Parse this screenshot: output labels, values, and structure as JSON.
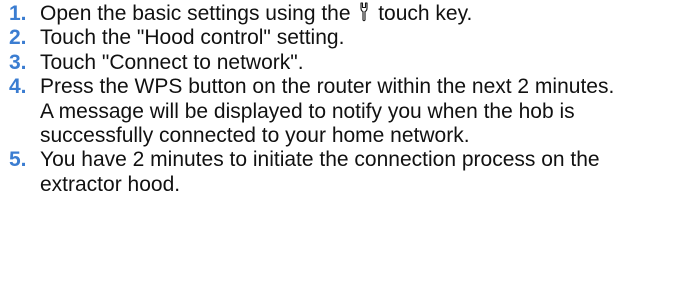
{
  "colors": {
    "step_number": "#3b7dd1",
    "text": "#111111",
    "background": "#ffffff"
  },
  "steps": [
    {
      "number": "1.",
      "text_before_icon": "Open the basic settings using the",
      "icon": "wrench-icon",
      "text_after_icon": "touch key."
    },
    {
      "number": "2.",
      "text": "Touch the \"Hood control\" setting."
    },
    {
      "number": "3.",
      "text": "Touch \"Connect to network\"."
    },
    {
      "number": "4.",
      "text": "Press the WPS button on the router within the next 2 minutes.",
      "note": "A message will be displayed to notify you when the hob is successfully connected to your home network."
    },
    {
      "number": "5.",
      "text": "You have 2 minutes to initiate the connection process on the extractor hood."
    }
  ]
}
